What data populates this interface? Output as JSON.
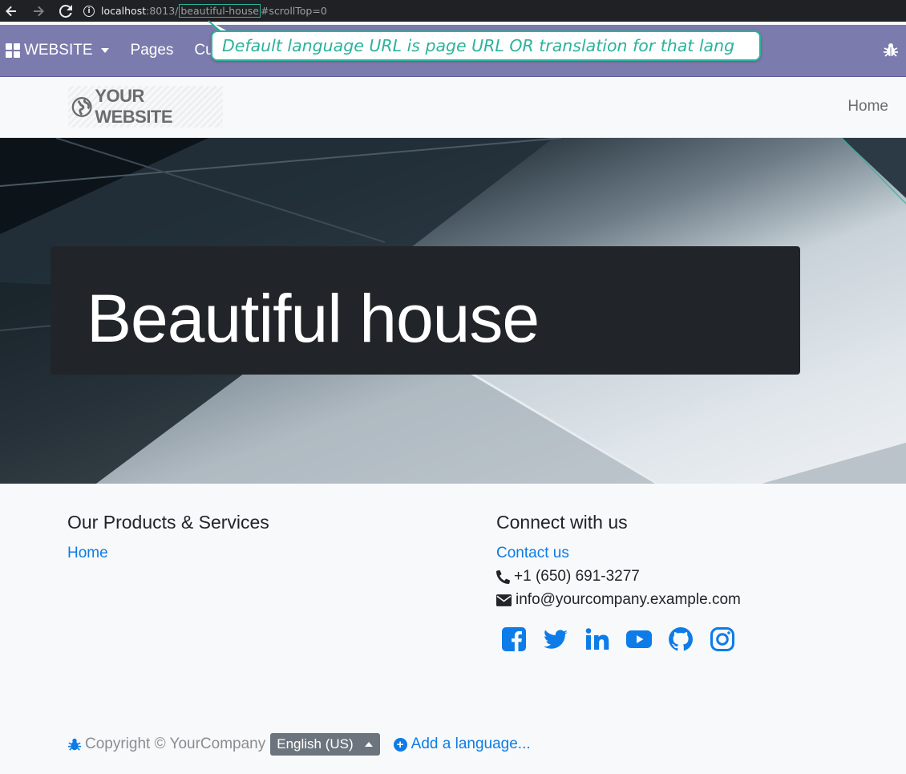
{
  "browser": {
    "url_host": "localhost",
    "url_port": ":8013/",
    "url_path": "beautiful-house",
    "url_hash": "#scrollTop=0"
  },
  "odoo_menu": {
    "apps_label": "WEBSITE",
    "pages_label": "Pages",
    "customize_label_partial": "Cu"
  },
  "callout": {
    "text": "Default language URL is page URL OR translation for that lang"
  },
  "site_header": {
    "logo_text": "YOUR WEBSITE",
    "nav_home": "Home"
  },
  "hero": {
    "title": "Beautiful house"
  },
  "footer": {
    "products": {
      "heading": "Our Products & Services",
      "links": [
        "Home"
      ]
    },
    "connect": {
      "heading": "Connect with us",
      "contact_link": "Contact us",
      "phone": "+1 (650) 691-3277",
      "email": "info@yourcompany.example.com",
      "social_icons": [
        "facebook-icon",
        "twitter-icon",
        "linkedin-icon",
        "youtube-icon",
        "github-icon",
        "instagram-icon"
      ]
    },
    "copyright": "Copyright © YourCompany",
    "language_selected": "English (US)",
    "add_language": "Add a language..."
  },
  "colors": {
    "odoo_menu_bg": "#7c7bad",
    "callout_accent": "#2bb39a",
    "link": "#0d7ce8",
    "hero_box": "#212529"
  }
}
